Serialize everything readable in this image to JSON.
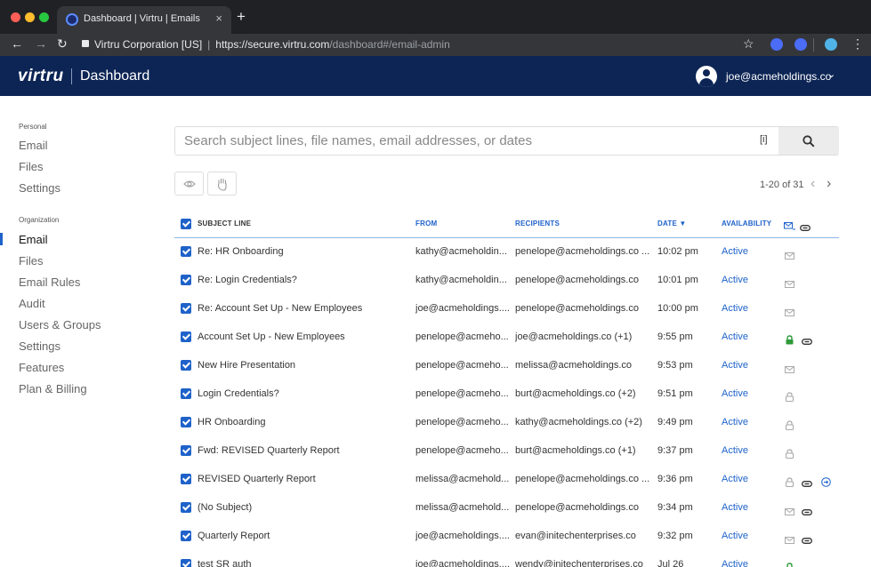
{
  "browser": {
    "tab_title": "Dashboard | Virtru | Emails",
    "tab_close": "×",
    "new_tab": "+",
    "site_identity": "Virtru Corporation [US]",
    "url_host": "https://secure.virtru.com",
    "url_path": "/dashboard#/email-admin"
  },
  "header": {
    "logo": "virtru",
    "title": "Dashboard",
    "user_email": "joe@acmeholdings.co"
  },
  "sidebar": {
    "personal_heading": "Personal",
    "personal_items": [
      "Email",
      "Files",
      "Settings"
    ],
    "org_heading": "Organization",
    "org_items": [
      "Email",
      "Files",
      "Email Rules",
      "Audit",
      "Users & Groups",
      "Settings",
      "Features",
      "Plan & Billing"
    ],
    "active_item": "Email"
  },
  "search": {
    "placeholder": "Search subject lines, file names, email addresses, or dates",
    "info_label": "[i]"
  },
  "pagination": {
    "label": "1-20 of 31"
  },
  "table": {
    "columns": {
      "subject": "SUBJECT LINE",
      "from": "FROM",
      "recipients": "RECIPIENTS",
      "date": "DATE ▼",
      "availability": "AVAILABILITY"
    },
    "rows": [
      {
        "subject": "Re: HR Onboarding",
        "from": "kathy@acmeholdin...",
        "recipients": "penelope@acmeholdings.co ...",
        "date": "10:02 pm",
        "availability": "Active",
        "icons": [
          "mail"
        ]
      },
      {
        "subject": "Re: Login Credentials?",
        "from": "kathy@acmeholdin...",
        "recipients": "penelope@acmeholdings.co",
        "date": "10:01 pm",
        "availability": "Active",
        "icons": [
          "mail"
        ]
      },
      {
        "subject": "Re: Account Set Up - New Employees",
        "from": "joe@acmeholdings....",
        "recipients": "penelope@acmeholdings.co",
        "date": "10:00 pm",
        "availability": "Active",
        "icons": [
          "mail"
        ]
      },
      {
        "subject": "Account Set Up - New Employees",
        "from": "penelope@acmeho...",
        "recipients": "joe@acmeholdings.co (+1)",
        "date": "9:55 pm",
        "availability": "Active",
        "icons": [
          "lock-green",
          "attachment"
        ]
      },
      {
        "subject": "New Hire Presentation",
        "from": "penelope@acmeho...",
        "recipients": "melissa@acmeholdings.co",
        "date": "9:53 pm",
        "availability": "Active",
        "icons": [
          "mail"
        ]
      },
      {
        "subject": "Login Credentials?",
        "from": "penelope@acmeho...",
        "recipients": "burt@acmeholdings.co (+2)",
        "date": "9:51 pm",
        "availability": "Active",
        "icons": [
          "lock"
        ]
      },
      {
        "subject": "HR Onboarding",
        "from": "penelope@acmeho...",
        "recipients": "kathy@acmeholdings.co (+2)",
        "date": "9:49 pm",
        "availability": "Active",
        "icons": [
          "lock"
        ]
      },
      {
        "subject": "Fwd: REVISED Quarterly Report",
        "from": "penelope@acmeho...",
        "recipients": "burt@acmeholdings.co (+1)",
        "date": "9:37 pm",
        "availability": "Active",
        "icons": [
          "lock"
        ]
      },
      {
        "subject": "REVISED Quarterly Report",
        "from": "melissa@acmehold...",
        "recipients": "penelope@acmeholdings.co ...",
        "date": "9:36 pm",
        "availability": "Active",
        "icons": [
          "lock",
          "attachment",
          "forward"
        ]
      },
      {
        "subject": "(No Subject)",
        "from": "melissa@acmehold...",
        "recipients": "penelope@acmeholdings.co",
        "date": "9:34 pm",
        "availability": "Active",
        "icons": [
          "mail",
          "attachment"
        ]
      },
      {
        "subject": "Quarterly Report",
        "from": "joe@acmeholdings....",
        "recipients": "evan@initechenterprises.co",
        "date": "9:32 pm",
        "availability": "Active",
        "icons": [
          "mail",
          "attachment"
        ]
      },
      {
        "subject": "test SR auth",
        "from": "joe@acmeholdings....",
        "recipients": "wendy@initechenterprises.co",
        "date": "Jul 26",
        "availability": "Active",
        "icons": [
          "lock-green"
        ]
      }
    ]
  },
  "colors": {
    "brand_navy": "#0c2555",
    "accent_blue": "#1e62c9",
    "lock_green": "#2e9b3a"
  }
}
